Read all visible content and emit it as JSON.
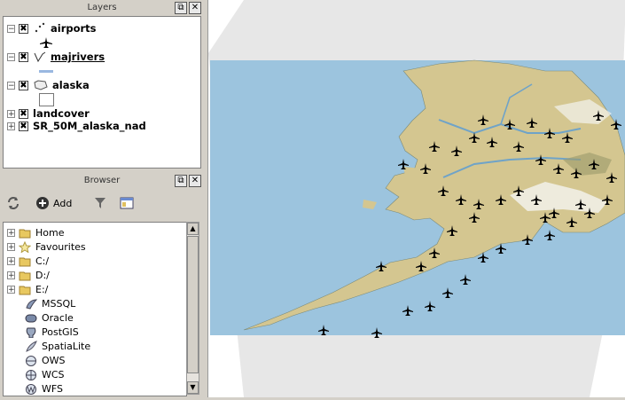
{
  "layers_panel": {
    "title": "Layers",
    "float_icon": "float-icon",
    "close_icon": "close-icon",
    "layers": [
      {
        "name": "airports",
        "checked": true,
        "expanded": true,
        "icon": "points-icon"
      },
      {
        "name": "majrivers",
        "checked": true,
        "expanded": true,
        "icon": "line-icon"
      },
      {
        "name": "alaska",
        "checked": true,
        "expanded": true,
        "icon": "polygon-icon"
      },
      {
        "name": "landcover",
        "checked": true,
        "expanded": false
      },
      {
        "name": "SR_50M_alaska_nad",
        "checked": true,
        "expanded": false
      }
    ]
  },
  "browser_panel": {
    "title": "Browser",
    "toolbar": {
      "refresh_icon": "refresh-icon",
      "add_label": "Add",
      "filter_icon": "filter-icon",
      "properties_icon": "properties-icon"
    },
    "items": [
      {
        "label": "Home",
        "icon": "folder-icon",
        "expandable": true
      },
      {
        "label": "Favourites",
        "icon": "star-icon",
        "expandable": true
      },
      {
        "label": "C:/",
        "icon": "folder-icon",
        "expandable": true
      },
      {
        "label": "D:/",
        "icon": "folder-icon",
        "expandable": true
      },
      {
        "label": "E:/",
        "icon": "folder-icon",
        "expandable": true
      },
      {
        "label": "MSSQL",
        "icon": "mssql-icon",
        "expandable": false
      },
      {
        "label": "Oracle",
        "icon": "oracle-icon",
        "expandable": false
      },
      {
        "label": "PostGIS",
        "icon": "postgis-icon",
        "expandable": false
      },
      {
        "label": "SpatiaLite",
        "icon": "spatialite-icon",
        "expandable": false
      },
      {
        "label": "OWS",
        "icon": "ows-icon",
        "expandable": false
      },
      {
        "label": "WCS",
        "icon": "wcs-icon",
        "expandable": false
      },
      {
        "label": "WFS",
        "icon": "wfs-icon",
        "expandable": false
      }
    ]
  },
  "map": {
    "ocean_color": "#9cc4de",
    "land_color": "#d4c690",
    "airport_color": "#000000"
  }
}
